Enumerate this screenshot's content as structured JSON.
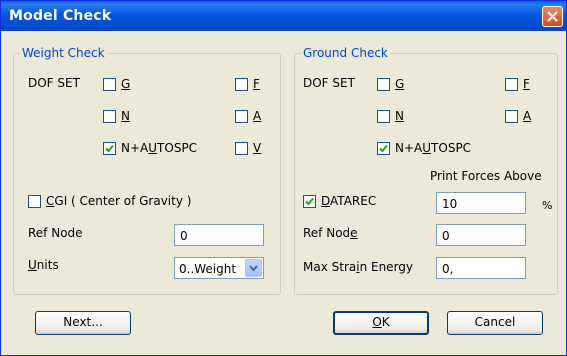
{
  "window": {
    "title": "Model Check"
  },
  "weight_check": {
    "title": "Weight Check",
    "dof_label": "DOF SET",
    "checkboxes": [
      {
        "prefix": "",
        "key": "G",
        "suffix": "",
        "checked": false
      },
      {
        "prefix": "",
        "key": "F",
        "suffix": "",
        "checked": false
      },
      {
        "prefix": "",
        "key": "N",
        "suffix": "",
        "checked": false
      },
      {
        "prefix": "",
        "key": "A",
        "suffix": "",
        "checked": false
      },
      {
        "prefix": "N+A",
        "key": "U",
        "suffix": "TOSPC",
        "checked": true
      },
      {
        "prefix": "",
        "key": "V",
        "suffix": "",
        "checked": false
      }
    ],
    "cgi": {
      "prefix": "",
      "key": "C",
      "suffix": "GI ( Center of Gravity )",
      "checked": false
    },
    "ref_node_label": "Ref Node",
    "ref_node_value": "0",
    "units_label_key": "U",
    "units_label_rest": "nits",
    "units_value": "0..Weight"
  },
  "ground_check": {
    "title": "Ground Check",
    "dof_label": "DOF SET",
    "checkboxes": [
      {
        "prefix": "",
        "key": "G",
        "suffix": "",
        "checked": false
      },
      {
        "prefix": "",
        "key": "F",
        "suffix": "",
        "checked": false
      },
      {
        "prefix": "",
        "key": "N",
        "suffix": "",
        "checked": false
      },
      {
        "prefix": "",
        "key": "A",
        "suffix": "",
        "checked": false
      },
      {
        "prefix": "N+A",
        "key": "U",
        "suffix": "TOSPC",
        "checked": true
      }
    ],
    "print_forces_label": "Print Forces Above",
    "datarec": {
      "prefix": "",
      "key": "D",
      "suffix": "ATAREC",
      "checked": true
    },
    "datarec_value": "10",
    "percent": "%",
    "ref_node_label_prefix": "Ref Nod",
    "ref_node_label_key": "e",
    "ref_node_value": "0",
    "strain_label_prefix": "Max Stra",
    "strain_label_key": "i",
    "strain_label_suffix": "n Energy",
    "strain_value": "0,"
  },
  "buttons": {
    "next": "Next...",
    "ok_key": "O",
    "ok_rest": "K",
    "cancel": "Cancel"
  },
  "colors": {
    "title_bar": "#0558e0",
    "group_title": "#0046d5",
    "dialog_bg": "#ece9d8"
  }
}
